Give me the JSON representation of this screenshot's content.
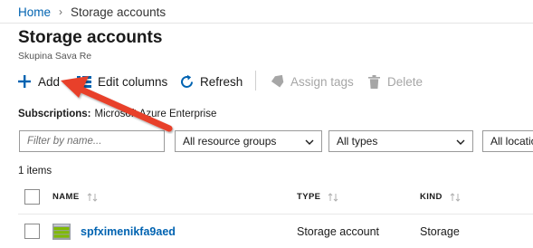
{
  "breadcrumb": {
    "home": "Home",
    "current": "Storage accounts"
  },
  "page": {
    "title": "Storage accounts",
    "subtitle": "Skupina Sava Re"
  },
  "toolbar": {
    "add": "Add",
    "edit_columns": "Edit columns",
    "refresh": "Refresh",
    "assign_tags": "Assign tags",
    "delete": "Delete"
  },
  "subscriptions": {
    "label": "Subscriptions:",
    "value": "Microsoft Azure Enterprise"
  },
  "filters": {
    "name_placeholder": "Filter by name...",
    "resource_groups": "All resource groups",
    "types": "All types",
    "locations": "All locations"
  },
  "list": {
    "count_text": "1 items",
    "columns": {
      "name": "NAME",
      "type": "TYPE",
      "kind": "KIND"
    },
    "rows": [
      {
        "name": "spfximenikfa9aed",
        "type": "Storage account",
        "kind": "Storage"
      }
    ]
  },
  "colors": {
    "link": "#0063b1",
    "annotation_arrow": "#e8412c"
  }
}
